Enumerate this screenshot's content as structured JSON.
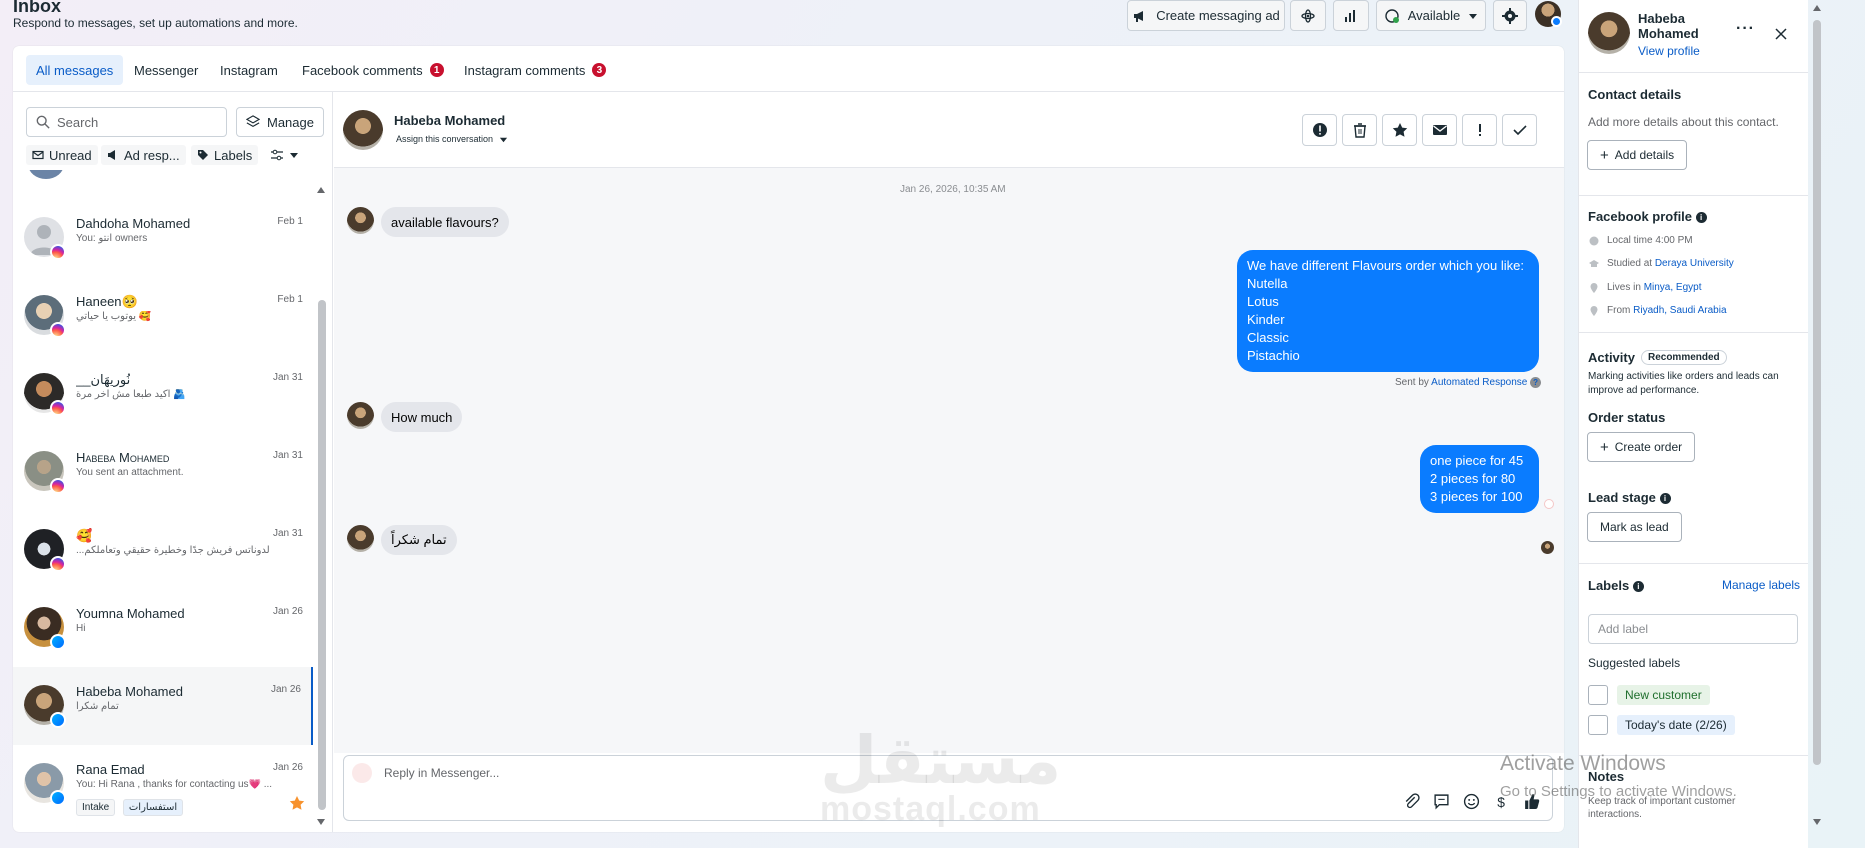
{
  "header": {
    "title": "Inbox",
    "subtitle": "Respond to messages, set up automations and more.",
    "create_ad_label": "Create messaging ad",
    "availability_label": "Available"
  },
  "tabs": [
    {
      "label": "All messages",
      "badge": ""
    },
    {
      "label": "Messenger",
      "badge": ""
    },
    {
      "label": "Instagram",
      "badge": ""
    },
    {
      "label": "Facebook comments",
      "badge": "1"
    },
    {
      "label": "Instagram comments",
      "badge": "3"
    }
  ],
  "list": {
    "search_placeholder": "Search",
    "manage_label": "Manage",
    "filters": [
      "Unread",
      "Ad resp...",
      "Labels"
    ],
    "conversations": [
      {
        "name": "Dahdoha Mohamed",
        "date": "Feb 1",
        "snippet": "You: انتو owners",
        "platform": "instagram"
      },
      {
        "name": "Haneen🥺",
        "date": "Feb 1",
        "snippet": "يوتوب يا حياتي 🥰",
        "platform": "instagram"
      },
      {
        "name": "__نُوريهَان",
        "date": "Jan 31",
        "snippet": "اكيد طبعا مش آخر مرة 🫂",
        "platform": "instagram"
      },
      {
        "name": "Habeba Mohamed",
        "date": "Jan 31",
        "snippet": "You sent an attachment.",
        "platform": "instagram"
      },
      {
        "name": "🥰",
        "date": "Jan 31",
        "snippet": "...لدوناتس فريش جدًا وخطيرة حقيقي وتعاملكم",
        "platform": "instagram"
      },
      {
        "name": "Youmna Mohamed",
        "date": "Jan 26",
        "snippet": "Hi",
        "platform": "messenger"
      },
      {
        "name": "Habeba Mohamed",
        "date": "Jan 26",
        "snippet": "تمام شكراً",
        "platform": "messenger"
      },
      {
        "name": "Rana Emad",
        "date": "Jan 26",
        "snippet": "You: Hi Rana , thanks for contacting us💗 ...",
        "platform": "messenger",
        "tags": [
          "Intake",
          "استفسارات"
        ]
      }
    ]
  },
  "chat": {
    "contact_name": "Habeba Mohamed",
    "assign_label": "Assign this conversation",
    "date_stamp": "Jan 26, 2026, 10:35 AM",
    "messages": {
      "m1": "available flavours?",
      "m2": "We have different Flavours order which you like:\nNutella\nLotus\nKinder\nClassic\nPistachio",
      "sent_by_prefix": "Sent by",
      "sent_by_link": "Automated Response",
      "m3": "How much",
      "m4": "one piece for 45\n2 pieces for 80\n3 pieces for 100",
      "m5": "تمام شكراً"
    },
    "reply_placeholder": "Reply in Messenger..."
  },
  "profile": {
    "first_name": "Habeba",
    "last_name": "Mohamed",
    "view_profile": "View profile",
    "contact_details_title": "Contact details",
    "contact_details_desc": "Add more details about this contact.",
    "add_details_label": "Add details",
    "facebook_profile_title": "Facebook profile",
    "local_time": "Local time 4:00 PM",
    "studied_prefix": "Studied at",
    "studied_at": "Deraya University",
    "lives_prefix": "Lives in",
    "lives_in": "Minya, Egypt",
    "from_prefix": "From",
    "from": "Riyadh, Saudi Arabia",
    "activity_title": "Activity",
    "recommended": "Recommended",
    "activity_desc": "Marking activities like orders and leads can improve ad performance.",
    "order_status_title": "Order status",
    "create_order_label": "Create order",
    "lead_stage_title": "Lead stage",
    "mark_as_lead_label": "Mark as lead",
    "labels_title": "Labels",
    "manage_labels": "Manage labels",
    "add_label_placeholder": "Add label",
    "suggested_labels_title": "Suggested labels",
    "suggested_labels": [
      "New customer",
      "Today's date (2/26)"
    ],
    "notes_title": "Notes",
    "notes_desc": "Keep track of important customer interactions."
  },
  "overlay": {
    "activate_title": "Activate Windows",
    "activate_desc": "Go to Settings to activate Windows.",
    "watermark_ar": "مستقل",
    "watermark_en": "mostaql.com"
  },
  "colors": {
    "accent": "#0a7cff",
    "badge": "#c8102e",
    "link": "#0a5cc7"
  }
}
